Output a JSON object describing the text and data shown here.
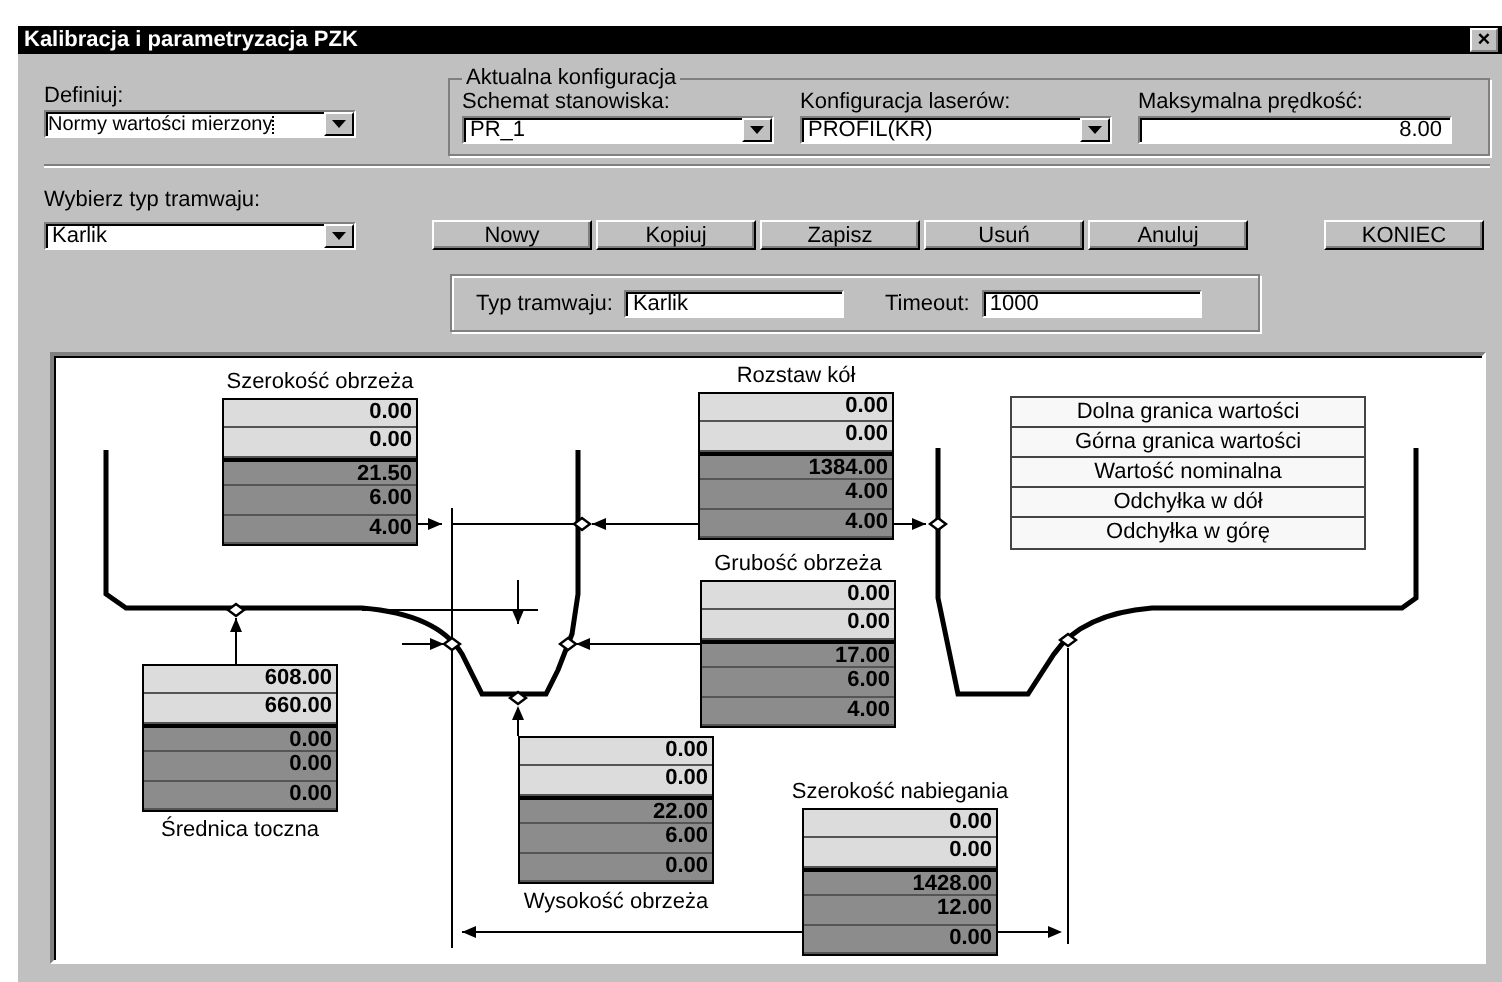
{
  "window": {
    "title": "Kalibracja i parametryzacja PZK",
    "close": "×"
  },
  "definiuj": {
    "label": "Definiuj:",
    "value": "Normy wartości mierzony"
  },
  "config_group": {
    "title": "Aktualna konfiguracja",
    "fields": [
      {
        "kind": "combo",
        "label": "Schemat stanowiska:",
        "value": "PR_1"
      },
      {
        "kind": "combo",
        "label": "Konfiguracja laserów:",
        "value": "PROFIL(KR)"
      },
      {
        "kind": "number",
        "label": "Maksymalna prędkość:",
        "value": "8.00"
      }
    ]
  },
  "tram_select": {
    "label": "Wybierz typ tramwaju:",
    "value": "Karlik"
  },
  "buttons": [
    "Nowy",
    "Kopiuj",
    "Zapisz",
    "Usuń",
    "Anuluj"
  ],
  "close_button": "KONIEC",
  "tram_fields": [
    {
      "label": "Typ tramwaju:",
      "value": "Karlik"
    },
    {
      "label": "Timeout:",
      "value": "1000"
    }
  ],
  "measurements": [
    {
      "label": "Szerokość obrzeża",
      "values": [
        "0.00",
        "0.00",
        "21.50",
        "6.00",
        "4.00"
      ]
    },
    {
      "label": "Rozstaw kół",
      "values": [
        "0.00",
        "0.00",
        "1384.00",
        "4.00",
        "4.00"
      ]
    },
    {
      "label": "Grubość obrzeża",
      "values": [
        "0.00",
        "0.00",
        "17.00",
        "6.00",
        "4.00"
      ]
    },
    {
      "label": "Średnica toczna",
      "values": [
        "608.00",
        "660.00",
        "0.00",
        "0.00",
        "0.00"
      ]
    },
    {
      "label": "Wysokość obrzeża",
      "values": [
        "0.00",
        "0.00",
        "22.00",
        "6.00",
        "0.00"
      ]
    },
    {
      "label": "Szerokość nabiegania",
      "values": [
        "0.00",
        "0.00",
        "1428.00",
        "12.00",
        "0.00"
      ]
    }
  ],
  "legend": [
    "Dolna granica wartości",
    "Górna granica wartości",
    "Wartość nominalna",
    "Odchyłka w dół",
    "Odchyłka w górę"
  ]
}
